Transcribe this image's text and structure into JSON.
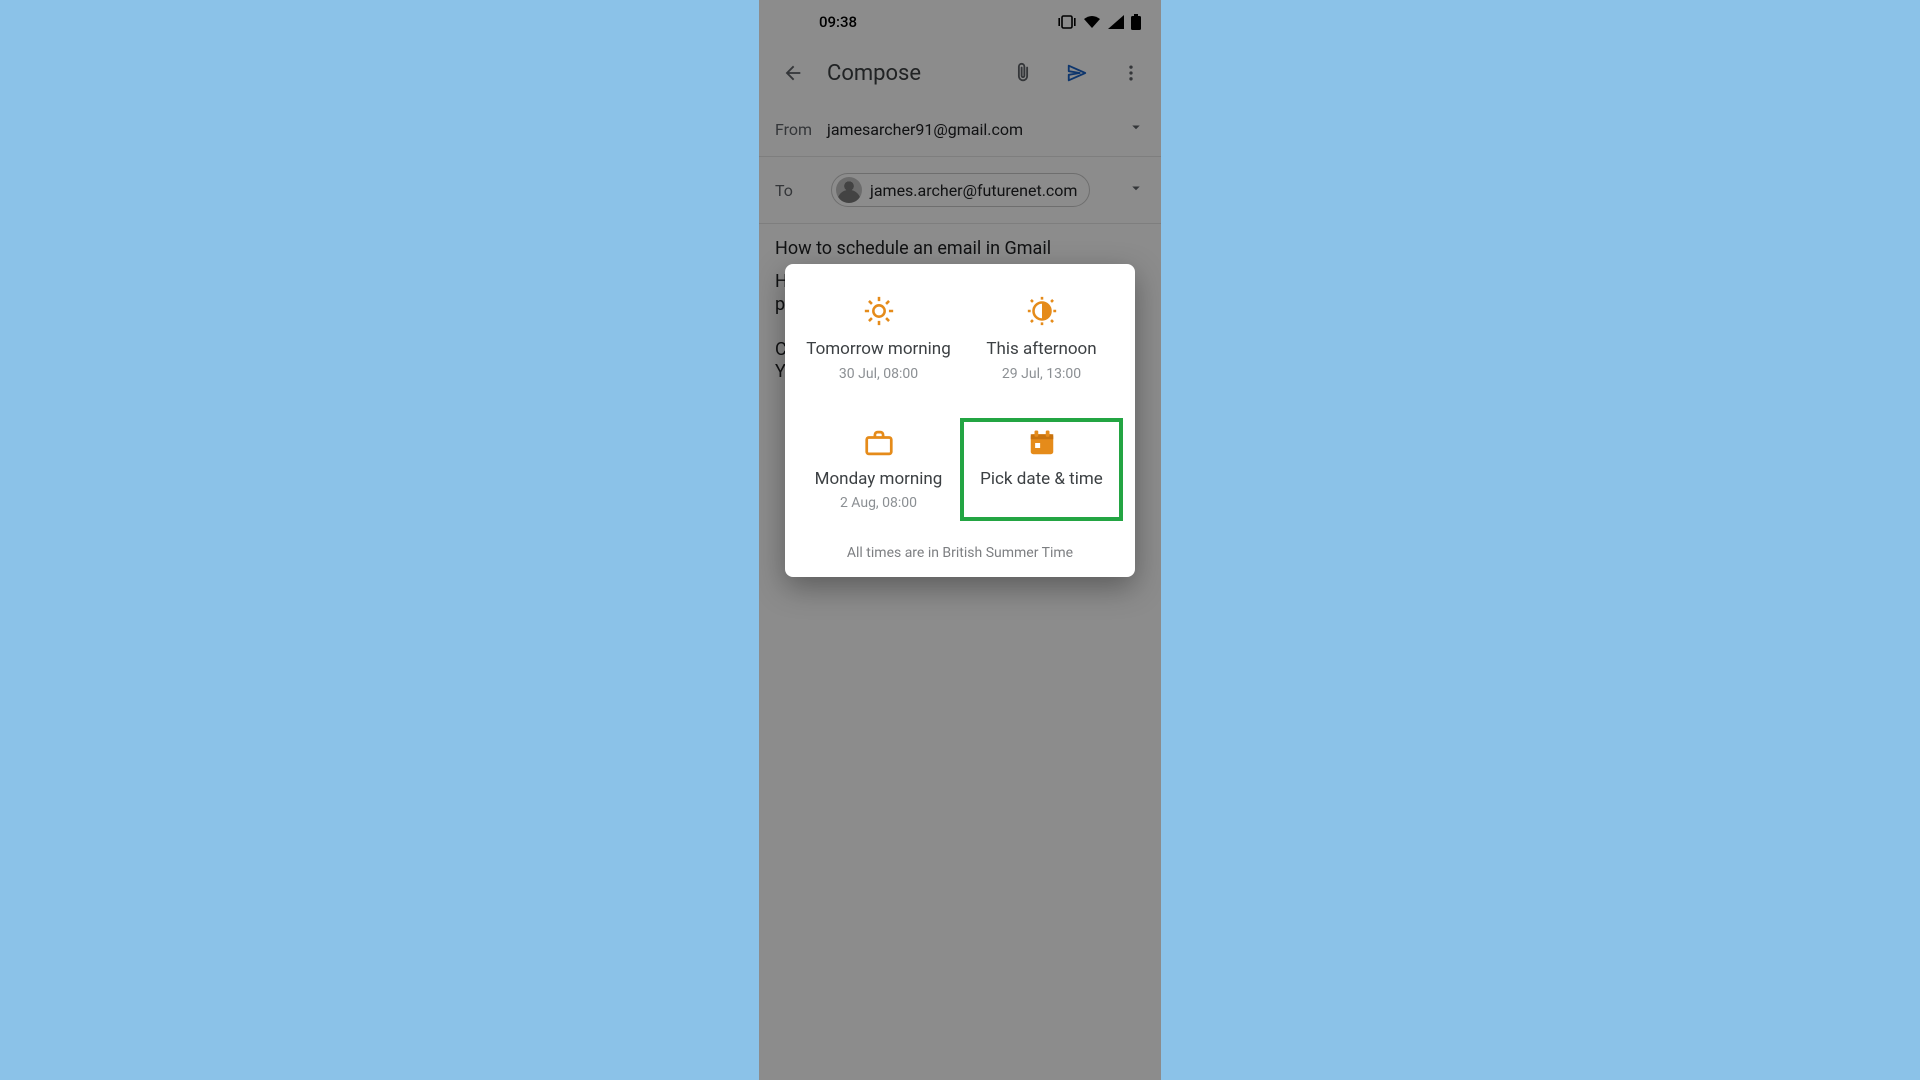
{
  "status": {
    "time": "09:38"
  },
  "appbar": {
    "title": "Compose"
  },
  "compose": {
    "from_label": "From",
    "from_value": "jamesarcher91@gmail.com",
    "to_label": "To",
    "to_chip": "james.archer@futurenet.com",
    "subject": "How to schedule an email in Gmail",
    "body_left_edge": "H\np\n\nC\nY"
  },
  "schedule_dialog": {
    "options": [
      {
        "title": "Tomorrow morning",
        "subtitle": "30 Jul, 08:00",
        "icon": "sun-gear",
        "highlighted": false
      },
      {
        "title": "This afternoon",
        "subtitle": "29 Jul, 13:00",
        "icon": "sun-half",
        "highlighted": false
      },
      {
        "title": "Monday morning",
        "subtitle": "2 Aug, 08:00",
        "icon": "briefcase",
        "highlighted": false
      },
      {
        "title": "Pick date & time",
        "subtitle": "",
        "icon": "calendar",
        "highlighted": true
      }
    ],
    "timezone_note": "All times are in British Summer Time"
  },
  "colors": {
    "accent_orange": "#e58b1a",
    "send_blue": "#1a73e8",
    "highlight_green": "#23a543",
    "page_bg": "#8bc2e8"
  }
}
